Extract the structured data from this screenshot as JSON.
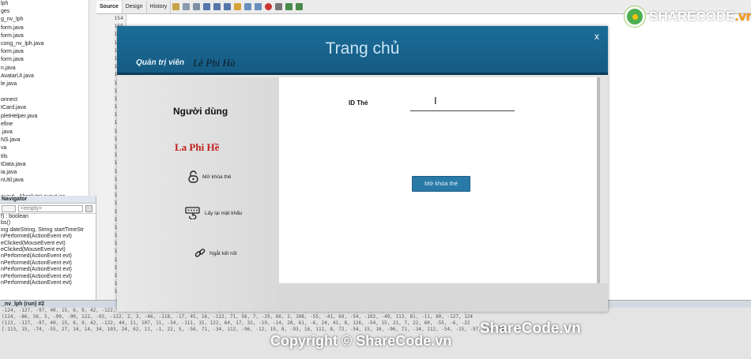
{
  "ide": {
    "project_files": [
      "lph",
      "ges",
      "g_nv_lph",
      "form.java",
      "form.java",
      "cong_nv_lph.java",
      "form.java",
      "form.java",
      "n.java",
      "AvatarUI.java",
      "le.java",
      "",
      "onnect",
      "tCard.java",
      "pletHelper.java",
      "efine",
      ".java",
      "NS.java",
      "va",
      "tils",
      "tData.java",
      "ia.java",
      "nUtil.java",
      "",
      "ayout - AbsoluteLayout.jar"
    ],
    "navigator_title": "Navigator",
    "navigator_empty": "<empty>",
    "navigator_items": [
      "f) : boolean",
      "bs()",
      "ing dateString, String startTimeStr",
      "nPerformed(ActionEvent evt)",
      "eClicked(MouseEvent evt)",
      "eClicked(MouseEvent evt)",
      "nPerformed(ActionEvent evt)",
      "nPerformed(ActionEvent evt)",
      "nPerformed(ActionEvent evt)",
      "nPerformed(ActionEvent evt)",
      "nPerformed(ActionEvent evt)"
    ],
    "tabs": [
      "Source",
      "Design",
      "History"
    ],
    "line_numbers": [
      "154",
      "155",
      "156",
      "157",
      "158",
      "159",
      "160",
      "161",
      "162",
      "163",
      "164",
      "165",
      "166",
      "167",
      "168",
      "169",
      "170",
      "171",
      "172",
      "173",
      "174",
      "175",
      "176",
      "177",
      "178",
      "179",
      "180",
      "181",
      "182",
      "183",
      "184",
      "185",
      "186",
      "187",
      "188"
    ],
    "output_title": "_nv_lph (run) #2",
    "output_lines": [
      "-124, -127, -97, 40, 15, 6, 9, 42, -122, 44, 11, 107, 11, -34, -111, 15, 122, 64, 17, 32, -19, -14, 28, 61, -6, 24, 41, 8, 9, -54, 15, 21, 7, 22, 60, -55, -6, -22, 69",
      "(124, -86, 56, 5, -99, -90, 122, -93, -122, 2, 3, -46, -118, -17, 45, 16, -122, 71, 56, 7, -29, 66, 2, 108, -55, -41, 69, -54, -102, -49, 113, 81, -11, 80, -127, 124",
      "(113, -127, -97, 40, 15, 6, 9, 42, -122, 44, 11, 107, 11, -34, -111, 15, 122, 64, 17, 32, -19, -14, 28, 61, -6, 24, 41, 8, 126, -54, 15, 21, 7, 22, 60, -55, -6, -22",
      "[-113, 15, -74, -55, 27, 14, 14, 34, 103, 24, 62, 11, -1, 22, 5, -56, 71, -34, 112, -96, -12, 19, 8, -93, 16, 111, 8, 72, -54, 15, 10, -96, 71, -34, 112, -54, -15, -97, -94, 16"
    ]
  },
  "logo": {
    "brand": "SHARECODE",
    "tld": ".vn"
  },
  "app": {
    "title": "Trang chủ",
    "close_label": "x",
    "role_label": "Quản trị viên",
    "admin_name": "Lê Phi Hà",
    "sidebar": {
      "user_title": "Người dùng",
      "user_name": "La Phi Hề",
      "items": [
        "Mở khóa thẻ",
        "Lấy lại mật khẩu",
        "Ngắt kết nối"
      ]
    },
    "main": {
      "id_label": "ID Thẻ",
      "id_value": "",
      "cursor": "I",
      "unlock_button": "Mở khóa thẻ"
    }
  },
  "watermark": {
    "brand": "ShareCode.vn",
    "copyright": "Copyright © ShareCode.vn"
  }
}
